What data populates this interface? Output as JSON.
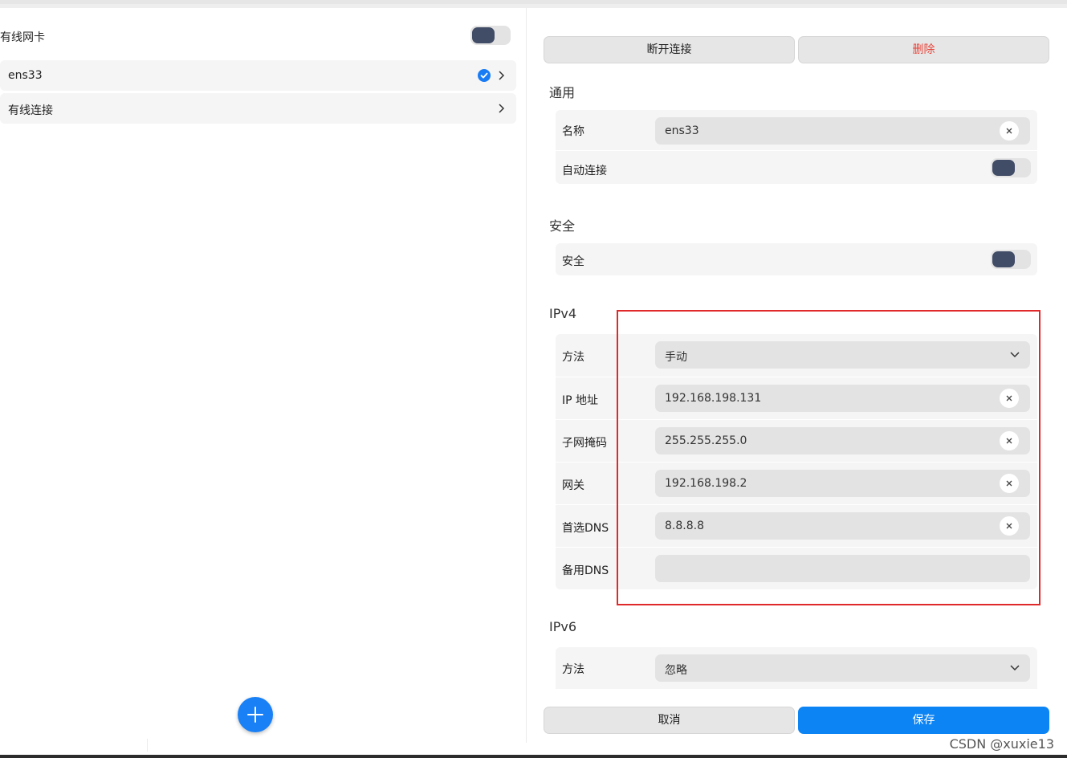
{
  "left": {
    "title": "有线网卡",
    "devices": [
      {
        "label": "ens33",
        "selected": true
      },
      {
        "label": "有线连接",
        "selected": false
      }
    ]
  },
  "actions": {
    "disconnect": "断开连接",
    "delete": "删除",
    "cancel": "取消",
    "save": "保存"
  },
  "general": {
    "title": "通用",
    "name_label": "名称",
    "name_value": "ens33",
    "auto_label": "自动连接"
  },
  "security": {
    "title": "安全",
    "label": "安全"
  },
  "ipv4": {
    "title": "IPv4",
    "method_label": "方法",
    "method_value": "手动",
    "ip_label": "IP 地址",
    "ip_value": "192.168.198.131",
    "mask_label": "子网掩码",
    "mask_value": "255.255.255.0",
    "gateway_label": "网关",
    "gateway_value": "192.168.198.2",
    "dns1_label": "首选DNS",
    "dns1_value": "8.8.8.8",
    "dns2_label": "备用DNS",
    "dns2_value": ""
  },
  "ipv6": {
    "title": "IPv6",
    "method_label": "方法",
    "method_value": "忽略"
  },
  "watermark": "CSDN @xuxie13",
  "colors": {
    "accent": "#0d84f4",
    "danger": "#e8443a",
    "toggle_knob": "#414c66",
    "highlight": "#e0292a"
  }
}
